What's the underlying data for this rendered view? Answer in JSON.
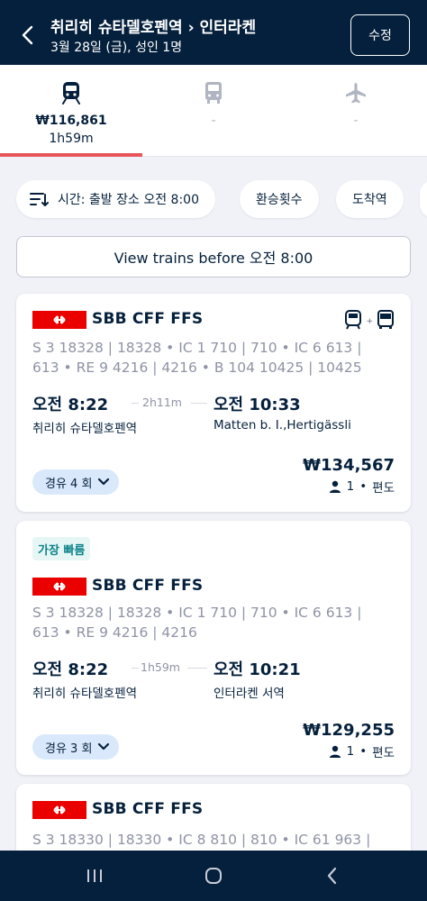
{
  "header": {
    "title": "취리히 슈타델호펜역 › 인터라켄",
    "subtitle": "3월 28일 (금), 성인 1명",
    "edit_label": "수정"
  },
  "tabs": [
    {
      "icon": "train-icon",
      "price": "₩116,861",
      "duration": "1h59m",
      "active": true
    },
    {
      "icon": "bus-icon",
      "price": "-",
      "active": false
    },
    {
      "icon": "plane-icon",
      "price": "-",
      "active": false
    }
  ],
  "filters": {
    "time_label": "시간: 출발 장소 오전 8:00",
    "transfers_label": "환승횟수",
    "arrival_label": "도착역"
  },
  "view_before_label": "View trains before 오전 8:00",
  "results": [
    {
      "operator": "SBB CFF FFS",
      "badge": "",
      "route_line1": "S 3 18328 | 18328 • IC 1 710 | 710 • IC 6 613 |",
      "route_line2": "613 • RE 9 4216 | 4216 • B 104 10425 | 10425",
      "depart_time": "오전 8:22",
      "duration": "2h11m",
      "arrive_time": "오전 10:33",
      "depart_station": "취리히 슈타델호펜역",
      "arrive_station": "Matten b. I.,Hertigässli",
      "stops": "경유 4 회",
      "price": "₩134,567",
      "passengers": "1",
      "trip_type": "편도"
    },
    {
      "operator": "SBB CFF FFS",
      "badge": "가장 빠름",
      "route_line1": "S 3 18328 | 18328 • IC 1 710 | 710 • IC 6 613 |",
      "route_line2": "613 • RE 9 4216 | 4216",
      "depart_time": "오전 8:22",
      "duration": "1h59m",
      "arrive_time": "오전 10:21",
      "depart_station": "취리히 슈타델호펜역",
      "arrive_station": "인터라켄 서역",
      "stops": "경유 3 회",
      "price": "₩129,255",
      "passengers": "1",
      "trip_type": "편도"
    },
    {
      "operator": "SBB CFF FFS",
      "route_line1": "S 3 18330 | 18330 • IC 8 810 | 810 • IC 61 963 |"
    }
  ],
  "colors": {
    "brand_dark": "#05203c",
    "active_tab": "#e7555a",
    "sbb_red": "#eb0000",
    "stops_pill": "#d9e9fb",
    "fastest_badge": "#0c838a"
  }
}
